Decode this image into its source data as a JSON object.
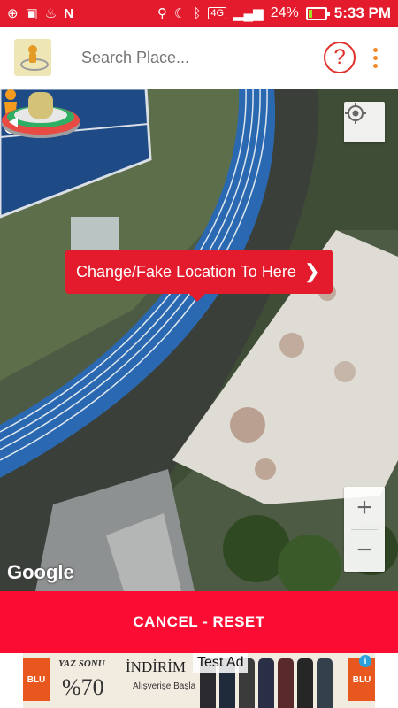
{
  "status_bar": {
    "network": "4G",
    "battery": "24%",
    "battery_level": 0.24,
    "time": "5:33 PM",
    "icons": [
      "download-icon",
      "image-icon",
      "flame-icon",
      "n-icon",
      "location-icon",
      "moon-icon",
      "bluetooth-icon",
      "signal-icon",
      "battery-charging-icon"
    ]
  },
  "app_bar": {
    "search_placeholder": "Search Place...",
    "help_icon": "?",
    "accent_color": "#e31b2c"
  },
  "map": {
    "callout_text": "Change/Fake Location To Here",
    "callout_chevron": "❯",
    "zoom_in": "+",
    "zoom_out": "−",
    "attribution": "Google"
  },
  "action_bar": {
    "label": "CANCEL - RESET",
    "color": "#fb0d33"
  },
  "ad": {
    "brand_left": "BLU",
    "brand_right": "BLU",
    "headline": "YAZ SONU",
    "discount": "%70",
    "sale": "İNDİRİM",
    "cta": "Alışverişe Başla",
    "label": "Test Ad",
    "info_icon": "i"
  }
}
